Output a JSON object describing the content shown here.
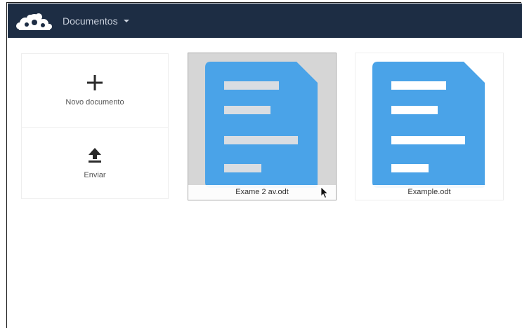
{
  "header": {
    "logo_icon": "owncloud-cloud-logo",
    "app_name": "Documentos",
    "bg_color": "#1d2d44"
  },
  "actions": {
    "new_document": {
      "label": "Novo documento",
      "icon": "plus-icon"
    },
    "upload": {
      "label": "Enviar",
      "icon": "upload-icon"
    }
  },
  "documents": [
    {
      "name": "Exame 2 av.odt",
      "selected": true,
      "thumbnail_color": "#4aa3e8"
    },
    {
      "name": "Example.odt",
      "selected": false,
      "thumbnail_color": "#4aa3e8"
    }
  ]
}
